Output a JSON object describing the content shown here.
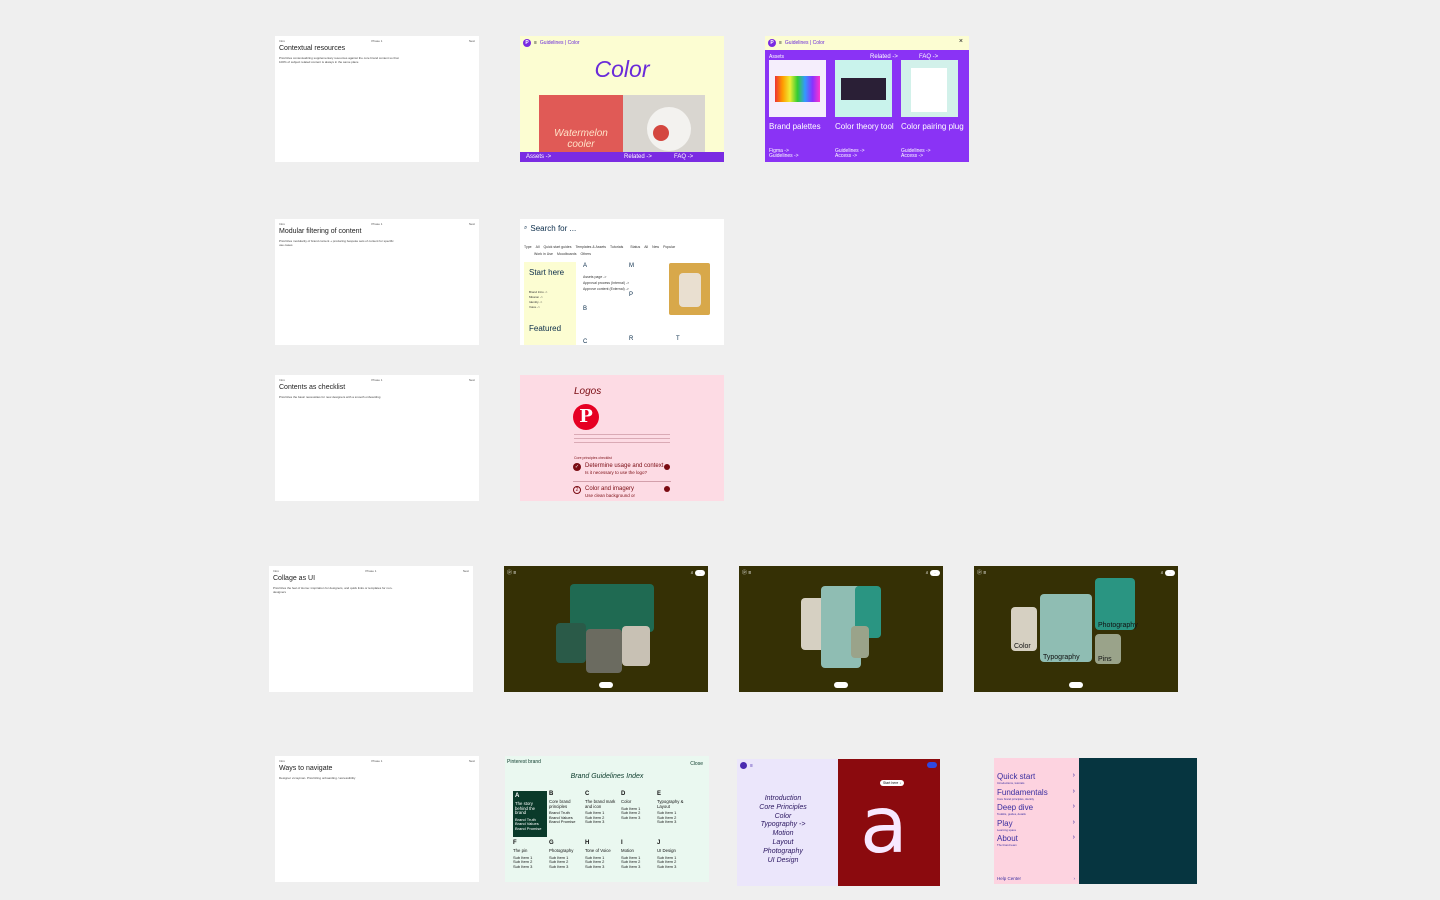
{
  "colors": {
    "canvas": "#efefef",
    "purple": "#7a2be2",
    "cream": "#fcfdd2",
    "pink": "#fddbe4",
    "olive": "#353005",
    "pinterest_red": "#e60023"
  },
  "rows": {
    "contextual": {
      "intro": {
        "title": "Contextual resources",
        "description": "Prioritizes contextualizing supplementary resources against the core brand content so that 100% of subject related content is always in the same place"
      },
      "color_page": {
        "breadcrumb": "Guidelines | Color",
        "title": "Color",
        "hero_text": "Watermelon cooler",
        "bottom_links": [
          "Assets ->",
          "Related ->",
          "FAQ ->"
        ]
      },
      "assets_page": {
        "breadcrumb": "Guidelines | Color",
        "close": "×",
        "tabs": [
          "Assets",
          "Related ->",
          "FAQ ->"
        ],
        "cards": [
          {
            "label": "Brand palettes",
            "links": [
              "Figma ->",
              "Guidelines ->"
            ]
          },
          {
            "label": "Color theory tool",
            "links": [
              "Guidelines ->",
              "Access ->"
            ]
          },
          {
            "label": "Color pairing plug",
            "links": [
              "Guidelines ->",
              "Access ->"
            ]
          }
        ]
      }
    },
    "modular": {
      "intro": {
        "title": "Modular filtering of content",
        "description": "Prioritizes modularity of brand content + producing bespoke sets of content for specific use cases"
      },
      "search_page": {
        "search_placeholder": "Search for ...",
        "type_label": "Type",
        "type_filters": [
          "All",
          "Quick start guides",
          "Templates & Assets",
          "Tutorials",
          "Work in Use",
          "Moodboards",
          "Others"
        ],
        "status_label": "Status",
        "status_filters": [
          "All",
          "New",
          "Popular"
        ],
        "sidebar_title": "Start here",
        "sidebar_items": [
          "Brand Intro ->",
          "Mission ->",
          "Identity ->",
          "Voice ->"
        ],
        "featured_title": "Featured",
        "letters": [
          "A",
          "M",
          "B",
          "P",
          "C",
          "R",
          "T"
        ],
        "items": [
          "Assets page ->",
          "Approval process (Internal) ->",
          "Approve content (External) ->"
        ]
      }
    },
    "checklist": {
      "intro": {
        "title": "Contents as checklist",
        "description": "Prioritizes the basic necessities for new designers with a smooth onboarding"
      },
      "logos_page": {
        "title": "Logos",
        "section_label": "Core principles checklist",
        "items": [
          {
            "num": "✓",
            "title": "Determine usage and context",
            "sub": "Is it necessary to use the logo?"
          },
          {
            "num": "2",
            "title": "Color and imagery",
            "sub": "Use clean background or"
          }
        ]
      }
    },
    "collage": {
      "intro": {
        "title": "Collage as UI",
        "description": "Prioritizes the feel of Home: inspiration for designers, and quick links or templates for non-designers"
      },
      "frame3_labels": [
        "Color",
        "Typography",
        "Photography",
        "Pins"
      ]
    },
    "navigate": {
      "intro": {
        "title": "Ways to navigate",
        "description": "Designer vs layman. Prioritizing onboarding / accessibility"
      },
      "index_page": {
        "brand": "Pinterest brand",
        "close": "Close",
        "title": "Brand Guidelines Index",
        "columns": [
          {
            "letter": "A",
            "heading": "The story behind the brand",
            "subs": [
              "Brand Truth",
              "Brand Values",
              "Brand Promise"
            ]
          },
          {
            "letter": "B",
            "heading": "Core brand principles",
            "subs": [
              "Brand Truth",
              "Brand Values",
              "Brand Promise"
            ]
          },
          {
            "letter": "C",
            "heading": "The brand mark and icon",
            "subs": [
              "Sub Item 1",
              "Sub Item 2",
              "Sub Item 3"
            ]
          },
          {
            "letter": "D",
            "heading": "Color",
            "subs": [
              "Sub Item 1",
              "Sub Item 2",
              "Sub Item 3"
            ]
          },
          {
            "letter": "E",
            "heading": "Typography & Layout",
            "subs": [
              "Sub Item 1",
              "Sub Item 2",
              "Sub Item 3"
            ]
          },
          {
            "letter": "F",
            "heading": "The pin",
            "subs": [
              "Sub Item 1",
              "Sub Item 2",
              "Sub Item 3"
            ]
          },
          {
            "letter": "G",
            "heading": "Photography",
            "subs": [
              "Sub Item 1",
              "Sub Item 2",
              "Sub Item 3"
            ]
          },
          {
            "letter": "H",
            "heading": "Tone of Voice",
            "subs": [
              "Sub Item 1",
              "Sub Item 2",
              "Sub Item 3"
            ]
          },
          {
            "letter": "I",
            "heading": "Motion",
            "subs": [
              "Sub Item 1",
              "Sub Item 2",
              "Sub Item 3"
            ]
          },
          {
            "letter": "J",
            "heading": "UI Design",
            "subs": [
              "Sub Item 1",
              "Sub Item 2",
              "Sub Item 3"
            ]
          }
        ]
      },
      "menu_page": {
        "items": [
          "Introduction",
          "Core Principles",
          "Color",
          "Typography ->",
          "Motion",
          "Layout",
          "Photography",
          "UI Design"
        ],
        "start_here": "Start here ↓",
        "glyph": "a"
      },
      "nav_page": {
        "items": [
          {
            "title": "Quick start",
            "sub": "Introductions, tutorials"
          },
          {
            "title": "Fundamentals",
            "sub": "Core brand principles, identity"
          },
          {
            "title": "Deep dive",
            "sub": "Toolkits, guides, details"
          },
          {
            "title": "Play",
            "sub": "Learning space"
          },
          {
            "title": "About",
            "sub": "The brand team"
          }
        ],
        "footer": "Help Center"
      }
    }
  }
}
